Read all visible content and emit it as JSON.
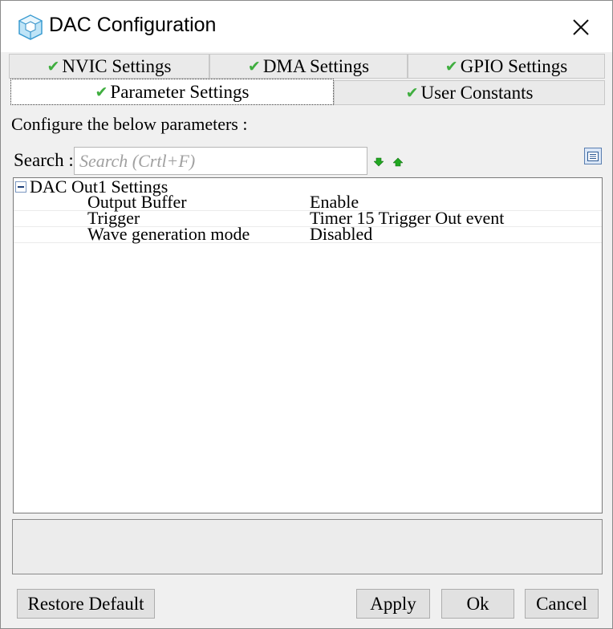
{
  "window": {
    "title": "DAC Configuration"
  },
  "tabs": {
    "row1": [
      {
        "label": "NVIC Settings",
        "checked": true
      },
      {
        "label": "DMA Settings",
        "checked": true
      },
      {
        "label": "GPIO Settings",
        "checked": true
      }
    ],
    "row2": [
      {
        "label": "Parameter Settings",
        "checked": true,
        "active": true
      },
      {
        "label": "User Constants",
        "checked": true
      }
    ]
  },
  "content": {
    "instruction": "Configure the below parameters :",
    "search": {
      "label": "Search :",
      "placeholder": "Search (Crtl+F)",
      "value": ""
    }
  },
  "tree": {
    "group": {
      "label": "DAC Out1 Settings",
      "expanded": true,
      "params": [
        {
          "name": "Output Buffer",
          "value": "Enable"
        },
        {
          "name": "Trigger",
          "value": "Timer 15 Trigger Out event"
        },
        {
          "name": "Wave generation mode",
          "value": "Disabled"
        }
      ]
    }
  },
  "buttons": {
    "restore": "Restore Default",
    "apply": "Apply",
    "ok": "Ok",
    "cancel": "Cancel"
  },
  "icons": {
    "check": "check-icon",
    "search_next": "arrow-down-icon",
    "search_prev": "arrow-up-icon",
    "view": "list-view-icon",
    "close": "close-icon",
    "app": "cube-icon"
  },
  "colors": {
    "check": "#3fae3f",
    "arrows": "#22a822",
    "accent": "#5a7fb0"
  }
}
